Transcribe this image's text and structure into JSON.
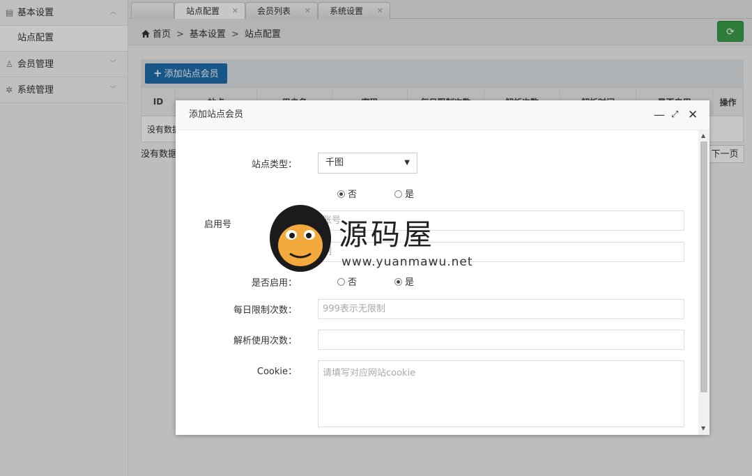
{
  "sidebar": {
    "groups": [
      {
        "label": "基本设置",
        "expanded": true,
        "sub": [
          "站点配置"
        ]
      },
      {
        "label": "会员管理",
        "expanded": false
      },
      {
        "label": "系统管理",
        "expanded": false
      }
    ]
  },
  "tabs": [
    {
      "label": ""
    },
    {
      "label": "站点配置"
    },
    {
      "label": "会员列表"
    },
    {
      "label": "系统设置"
    }
  ],
  "breadcrumb": {
    "items": [
      "首页",
      "基本设置",
      "站点配置"
    ],
    "sep": ">"
  },
  "toolbar": {
    "add_label": "添加站点会员"
  },
  "table": {
    "columns": [
      "ID",
      "站点",
      "用户名",
      "密码",
      "每日限制次数",
      "解析次数",
      "解析时间",
      "是否启用",
      "操作"
    ],
    "empty_row": "没有数据"
  },
  "empty_text": "没有数据",
  "pager": {
    "next_label": "下一页"
  },
  "modal": {
    "title": "添加站点会员",
    "site_type_label": "站点类型：",
    "site_type_value": "千图",
    "row2_opt1": "否",
    "row2_opt2": "是",
    "row3_label": "启用号",
    "row3_placeholder": "账号",
    "row4_placeholder": "制",
    "enabled_label": "是否启用：",
    "enabled_opt1": "否",
    "enabled_opt2": "是",
    "daily_label": "每日限制次数：",
    "daily_placeholder": "999表示无限制",
    "used_label": "解析使用次数：",
    "cookie_label": "Cookie：",
    "cookie_placeholder": "请填写对应网站cookie"
  },
  "watermark": {
    "name": "源码屋",
    "url": "www.yuanmawu.net"
  },
  "colors": {
    "primary": "#1e6fae",
    "refresh": "#3c9f4b"
  }
}
